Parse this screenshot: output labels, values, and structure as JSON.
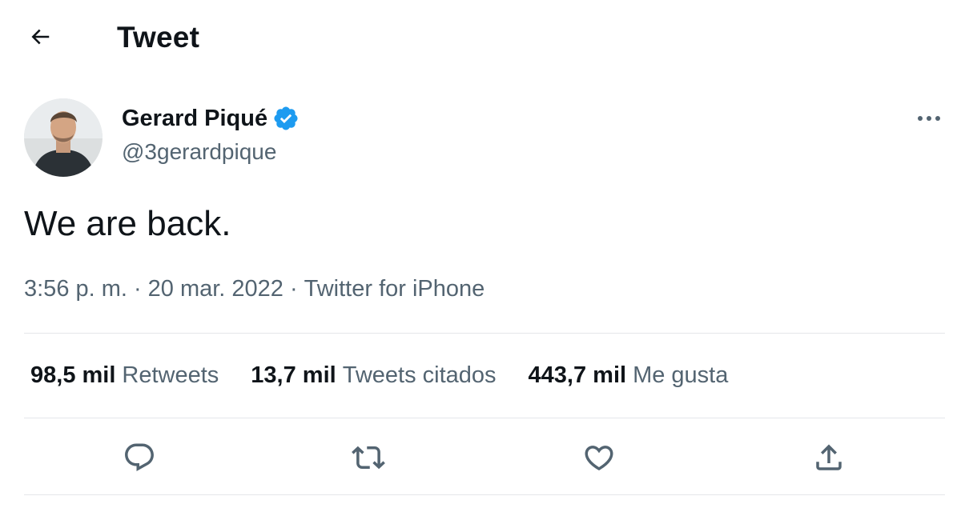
{
  "header": {
    "title": "Tweet",
    "back_icon": "arrow-left-icon"
  },
  "tweet": {
    "author": {
      "display_name": "Gerard Piqué",
      "handle": "@3gerardpique",
      "verified": true,
      "verified_icon": "verified-badge-icon"
    },
    "text": "We are back.",
    "meta": {
      "time": "3:56 p. m.",
      "separator": "·",
      "date": "20 mar. 2022",
      "source": "Twitter for iPhone"
    },
    "stats": [
      {
        "value": "98,5 mil",
        "label": "Retweets"
      },
      {
        "value": "13,7 mil",
        "label": "Tweets citados"
      },
      {
        "value": "443,7 mil",
        "label": "Me gusta"
      }
    ],
    "actions": [
      "reply-icon",
      "retweet-icon",
      "like-icon",
      "share-icon"
    ],
    "more_icon": "more-options-icon"
  },
  "colors": {
    "text_primary": "#0f1419",
    "text_secondary": "#536471",
    "verified_blue": "#1d9bf0",
    "divider": "#e4e7ea"
  }
}
